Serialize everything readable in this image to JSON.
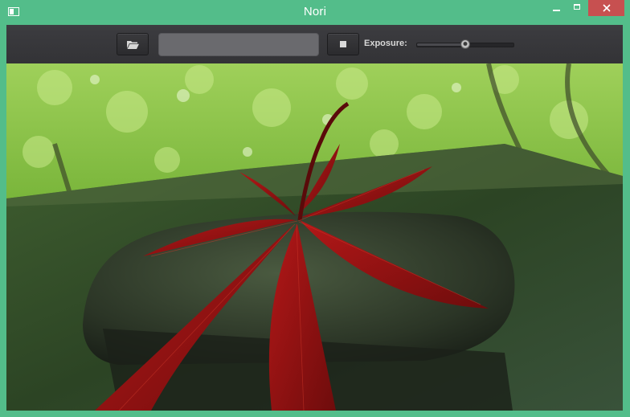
{
  "window": {
    "title": "Nori",
    "icon": "app-window-icon",
    "controls": [
      "minimize-icon",
      "maximize-icon",
      "close-icon"
    ],
    "accent": "#53bd8a",
    "close_color": "#c75050"
  },
  "toolbar": {
    "open_icon": "folder-open-icon",
    "path_value": "",
    "stop_icon": "stop-icon",
    "exposure_label": "Exposure:",
    "exposure_level": 0.5
  },
  "viewport": {
    "content": "rendered-image"
  }
}
